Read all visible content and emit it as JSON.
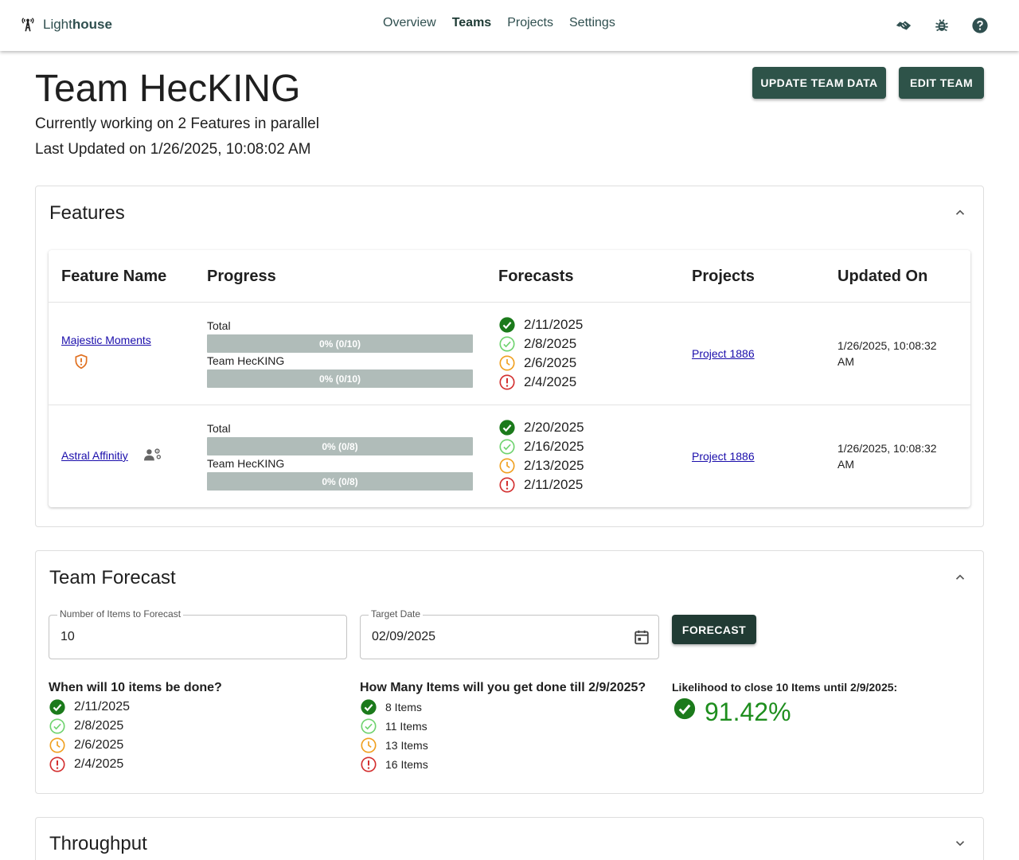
{
  "nav": {
    "brand_prefix": "Light",
    "brand_suffix": "house",
    "items": [
      "Overview",
      "Teams",
      "Projects",
      "Settings"
    ],
    "active": "Teams",
    "icons": [
      "handshake-icon",
      "bug-icon",
      "help-icon"
    ]
  },
  "header": {
    "title": "Team HecKING",
    "working": "Currently working on 2 Features in parallel",
    "updated": "Last Updated on 1/26/2025, 10:08:02 AM",
    "update_button": "UPDATE TEAM DATA",
    "edit_button": "EDIT TEAM"
  },
  "features": {
    "title": "Features",
    "columns": [
      "Feature Name",
      "Progress",
      "Forecasts",
      "Projects",
      "Updated On"
    ],
    "rows": [
      {
        "name": "Majestic Moments",
        "badge_icon": "shield-warning-icon",
        "total_label": "Total",
        "total_progress": "0% (0/10)",
        "team_label": "Team HecKING",
        "team_progress": "0% (0/10)",
        "forecasts": [
          "2/11/2025",
          "2/8/2025",
          "2/6/2025",
          "2/4/2025"
        ],
        "project": "Project 1886",
        "updated_line1": "1/26/2025, 10:08:32",
        "updated_line2": "AM"
      },
      {
        "name": "Astral Affinitiy",
        "badge_icon": "group-settings-icon",
        "total_label": "Total",
        "total_progress": "0% (0/8)",
        "team_label": "Team HecKING",
        "team_progress": "0% (0/8)",
        "forecasts": [
          "2/20/2025",
          "2/16/2025",
          "2/13/2025",
          "2/11/2025"
        ],
        "project": "Project 1886",
        "updated_line1": "1/26/2025, 10:08:32",
        "updated_line2": "AM"
      }
    ]
  },
  "forecast": {
    "title": "Team Forecast",
    "items_label": "Number of Items to Forecast",
    "items_value": "10",
    "date_label": "Target Date",
    "date_value": "02/09/2025",
    "button": "FORECAST",
    "when_title": "When will 10 items be done?",
    "when": [
      "2/11/2025",
      "2/8/2025",
      "2/6/2025",
      "2/4/2025"
    ],
    "howmany_title": "How Many Items will you get done till 2/9/2025?",
    "howmany": [
      "8 Items",
      "11 Items",
      "13 Items",
      "16 Items"
    ],
    "likelihood_title": "Likelihood to close 10 Items until 2/9/2025:",
    "likelihood_value": "91.42%"
  },
  "throughput": {
    "title": "Throughput"
  },
  "colors": {
    "primary": "#2e5349",
    "certain": "#1b7a1b",
    "likely": "#6fd36f",
    "risky": "#f0a020",
    "unlikely": "#d32f2f"
  }
}
